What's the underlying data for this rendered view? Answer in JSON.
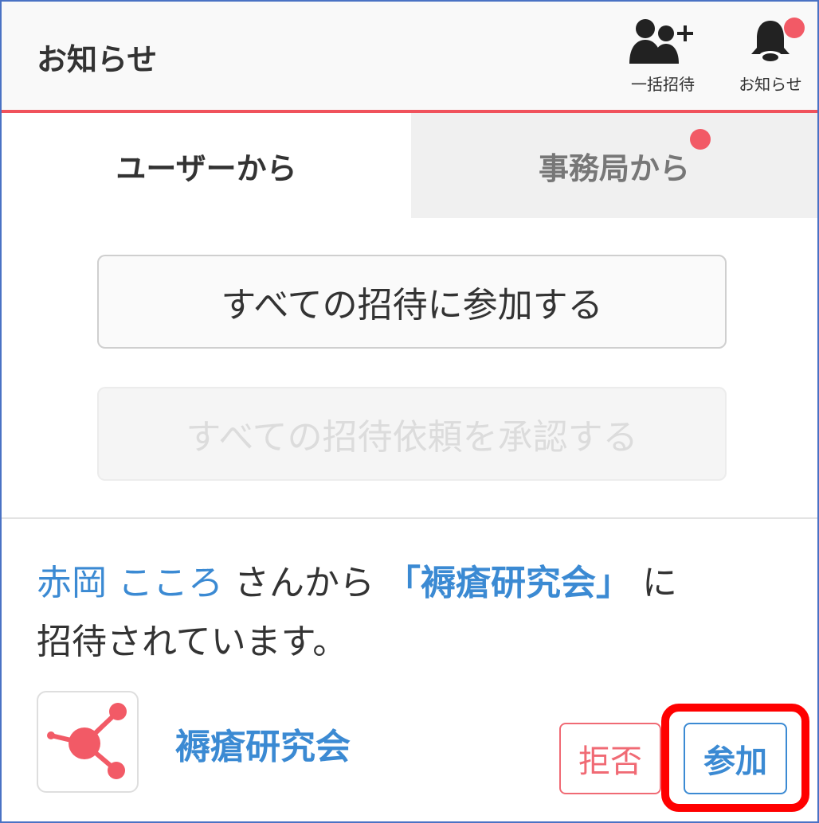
{
  "header": {
    "title": "お知らせ",
    "bulk_invite_label": "一括招待",
    "notifications_label": "お知らせ"
  },
  "tabs": [
    {
      "label": "ユーザーから",
      "active": true
    },
    {
      "label": "事務局から",
      "active": false,
      "has_badge": true
    }
  ],
  "actions": {
    "join_all_label": "すべての招待に参加する",
    "approve_all_label": "すべての招待依頼を承認する"
  },
  "invitation": {
    "inviter_name": "赤岡 こころ",
    "text_san_kara": " さんから ",
    "group_quoted": "「褥瘡研究会」",
    "text_ni": " に",
    "text_invited": "招待されています。",
    "group_name": "褥瘡研究会",
    "reject_label": "拒否",
    "join_label": "参加"
  },
  "colors": {
    "accent_red": "#f0525c",
    "link_blue": "#3b8ad3",
    "badge": "#f25a66",
    "highlight": "#ff0000"
  },
  "icons": [
    "users-add-icon",
    "bell-icon",
    "share-network-icon"
  ]
}
